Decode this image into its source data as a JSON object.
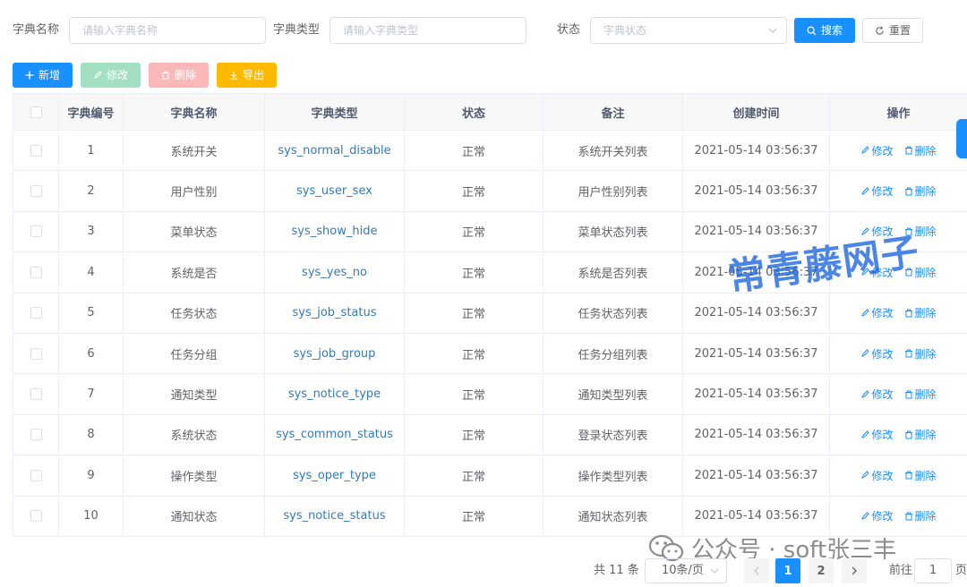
{
  "search": {
    "name_label": "字典名称",
    "name_placeholder": "请输入字典名称",
    "type_label": "字典类型",
    "type_placeholder": "请输入字典类型",
    "status_label": "状态",
    "status_placeholder": "字典状态",
    "search_btn": "搜索",
    "reset_btn": "重置"
  },
  "toolbar": {
    "add": "新增",
    "edit": "修改",
    "delete": "删除",
    "export": "导出"
  },
  "table": {
    "headers": [
      "字典编号",
      "字典名称",
      "字典类型",
      "状态",
      "备注",
      "创建时间",
      "操作"
    ],
    "rows": [
      {
        "id": "1",
        "name": "系统开关",
        "type": "sys_normal_disable",
        "status": "正常",
        "remark": "系统开关列表",
        "created": "2021-05-14 03:56:37"
      },
      {
        "id": "2",
        "name": "用户性别",
        "type": "sys_user_sex",
        "status": "正常",
        "remark": "用户性别列表",
        "created": "2021-05-14 03:56:37"
      },
      {
        "id": "3",
        "name": "菜单状态",
        "type": "sys_show_hide",
        "status": "正常",
        "remark": "菜单状态列表",
        "created": "2021-05-14 03:56:37"
      },
      {
        "id": "4",
        "name": "系统是否",
        "type": "sys_yes_no",
        "status": "正常",
        "remark": "系统是否列表",
        "created": "2021-05-14 03:56:37"
      },
      {
        "id": "5",
        "name": "任务状态",
        "type": "sys_job_status",
        "status": "正常",
        "remark": "任务状态列表",
        "created": "2021-05-14 03:56:37"
      },
      {
        "id": "6",
        "name": "任务分组",
        "type": "sys_job_group",
        "status": "正常",
        "remark": "任务分组列表",
        "created": "2021-05-14 03:56:37"
      },
      {
        "id": "7",
        "name": "通知类型",
        "type": "sys_notice_type",
        "status": "正常",
        "remark": "通知类型列表",
        "created": "2021-05-14 03:56:37"
      },
      {
        "id": "8",
        "name": "系统状态",
        "type": "sys_common_status",
        "status": "正常",
        "remark": "登录状态列表",
        "created": "2021-05-14 03:56:37"
      },
      {
        "id": "9",
        "name": "操作类型",
        "type": "sys_oper_type",
        "status": "正常",
        "remark": "操作类型列表",
        "created": "2021-05-14 03:56:37"
      },
      {
        "id": "10",
        "name": "通知状态",
        "type": "sys_notice_status",
        "status": "正常",
        "remark": "通知状态列表",
        "created": "2021-05-14 03:56:37"
      }
    ],
    "op_edit": "修改",
    "op_delete": "删除"
  },
  "pagination": {
    "total": "共 11 条",
    "page_size": "10条/页",
    "pages": [
      "1",
      "2"
    ],
    "current": "1",
    "goto_label": "前往",
    "goto_value": "1",
    "page_suffix": "页"
  },
  "watermark": "常青藤网子",
  "wechat_footer": "公众号 · soft张三丰",
  "colors": {
    "primary": "#1890ff",
    "success_plain": "#a3e0c1",
    "danger_plain": "#fbb8b8",
    "warning": "#ffba00",
    "link": "#337ab7"
  }
}
